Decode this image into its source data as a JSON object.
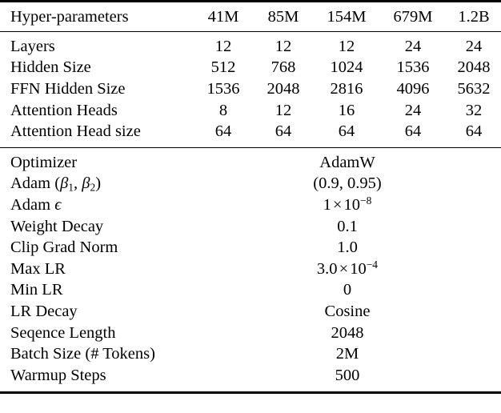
{
  "table": {
    "header": {
      "label": "Hyper-parameters",
      "columns": [
        "41M",
        "85M",
        "154M",
        "679M",
        "1.2B"
      ]
    },
    "arch_rows": [
      {
        "label": "Layers",
        "values": [
          "12",
          "12",
          "12",
          "24",
          "24"
        ]
      },
      {
        "label": "Hidden Size",
        "values": [
          "512",
          "768",
          "1024",
          "1536",
          "2048"
        ]
      },
      {
        "label": "FFN Hidden Size",
        "values": [
          "1536",
          "2048",
          "2816",
          "4096",
          "5632"
        ]
      },
      {
        "label": "Attention Heads",
        "values": [
          "8",
          "12",
          "16",
          "24",
          "32"
        ]
      },
      {
        "label": "Attention Head size",
        "values": [
          "64",
          "64",
          "64",
          "64",
          "64"
        ]
      }
    ],
    "train_rows": [
      {
        "label": "Optimizer",
        "label_math": false,
        "value": "AdamW",
        "value_math": false
      },
      {
        "label": "Adam (β1, β2)",
        "label_math": "adam_betas",
        "value": "(0.9, 0.95)",
        "value_math": false
      },
      {
        "label": "Adam ϵ",
        "label_math": "adam_eps",
        "value": "1 × 10⁻⁸",
        "value_math": "one_e_minus_8"
      },
      {
        "label": "Weight Decay",
        "label_math": false,
        "value": "0.1",
        "value_math": false
      },
      {
        "label": "Clip Grad Norm",
        "label_math": false,
        "value": "1.0",
        "value_math": false
      },
      {
        "label": "Max LR",
        "label_math": false,
        "value": "3.0 × 10⁻⁴",
        "value_math": "three_e_minus_4"
      },
      {
        "label": "Min LR",
        "label_math": false,
        "value": "0",
        "value_math": false
      },
      {
        "label": "LR Decay",
        "label_math": false,
        "value": "Cosine",
        "value_math": false
      },
      {
        "label": "Seqence Length",
        "label_math": false,
        "value": "2048",
        "value_math": false
      },
      {
        "label": "Batch Size (# Tokens)",
        "label_math": false,
        "value": "2M",
        "value_math": false
      },
      {
        "label": "Warmup Steps",
        "label_math": false,
        "value": "500",
        "value_math": false
      }
    ],
    "math": {
      "adam_betas": {
        "prefix": "Adam (",
        "beta": "β",
        "sub1": "1",
        "comma": ", ",
        "sub2": "2",
        "suffix": ")"
      },
      "adam_eps": {
        "prefix": "Adam ",
        "epsilon": "ϵ"
      },
      "one_e_minus_8": {
        "mantissa": "1",
        "times": "×",
        "base": "10",
        "exponent": "−8"
      },
      "three_e_minus_4": {
        "mantissa": "3.0",
        "times": "×",
        "base": "10",
        "exponent": "−4"
      }
    },
    "colors": {
      "rule": "#000000",
      "text": "#000000",
      "background": "#ffffff"
    }
  }
}
